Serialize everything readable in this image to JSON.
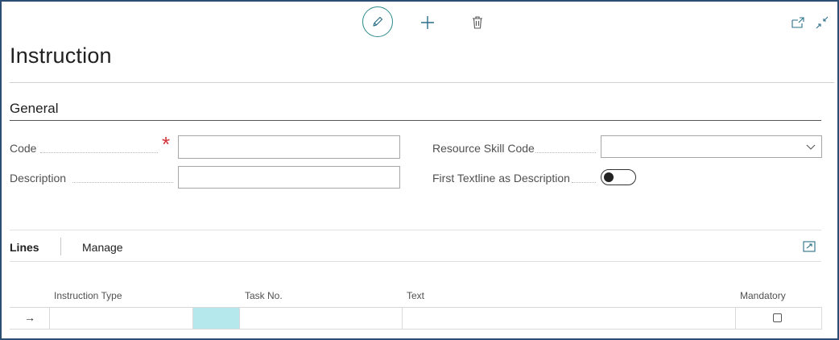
{
  "toolbar": {
    "edit_icon": "pencil-icon",
    "new_icon": "plus-icon",
    "delete_icon": "trash-icon",
    "open_new_window_icon": "open-in-new-window-icon",
    "collapse_icon": "collapse-icon"
  },
  "page": {
    "title": "Instruction"
  },
  "general": {
    "section_title": "General",
    "code_label": "Code",
    "code_value": "",
    "description_label": "Description",
    "description_value": "",
    "resource_skill_label": "Resource Skill Code",
    "resource_skill_value": "",
    "first_textline_label": "First Textline as Description",
    "first_textline_on": false
  },
  "lines": {
    "tab_lines": "Lines",
    "tab_manage": "Manage",
    "columns": [
      "Instruction Type",
      "Task No.",
      "Text",
      "Mandatory"
    ],
    "row_marker": "→",
    "rows": [
      {
        "instruction_type": "",
        "task_no": "",
        "text": "",
        "mandatory": false
      }
    ]
  },
  "colors": {
    "frame_border": "#2d4e73",
    "accent_teal": "#2b8a8c",
    "required": "#d13438",
    "selected_cell": "#b4e8ec"
  }
}
